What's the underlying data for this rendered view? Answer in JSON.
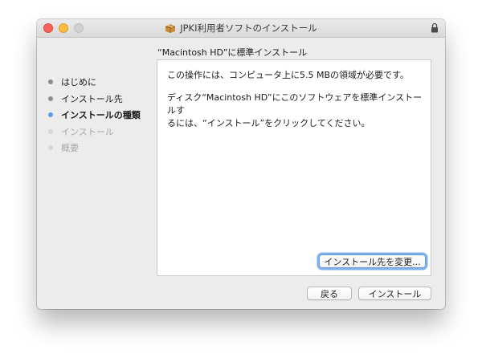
{
  "window": {
    "title": "JPKI利用者ソフトのインストール"
  },
  "sidebar": {
    "steps": [
      {
        "label": "はじめに",
        "state": "done"
      },
      {
        "label": "インストール先",
        "state": "done"
      },
      {
        "label": "インストールの種類",
        "state": "current"
      },
      {
        "label": "インストール",
        "state": "future"
      },
      {
        "label": "概要",
        "state": "future"
      }
    ]
  },
  "main": {
    "heading": "“Macintosh HD”に標準インストール",
    "paragraph1": "この操作には、コンピュータ上に5.5 MBの領域が必要です。",
    "paragraph2_line1": "ディスク“Macintosh HD”にこのソフトウェアを標準インストールす",
    "paragraph2_line2": "るには、“インストール”をクリックしてください。",
    "change_location_label": "インストール先を変更..."
  },
  "footer": {
    "back_label": "戻る",
    "install_label": "インストール"
  },
  "colors": {
    "current_step_dot": "#5a9ee8",
    "done_step_dot": "#8d8d8d",
    "future_step_text": "#a8a8a8",
    "focus_ring": "#7fb0ee",
    "close_button": "#fc605c",
    "minimize_button": "#fdbc40"
  },
  "icons": {
    "title_icon": "package-icon",
    "lock": "lock-icon"
  }
}
